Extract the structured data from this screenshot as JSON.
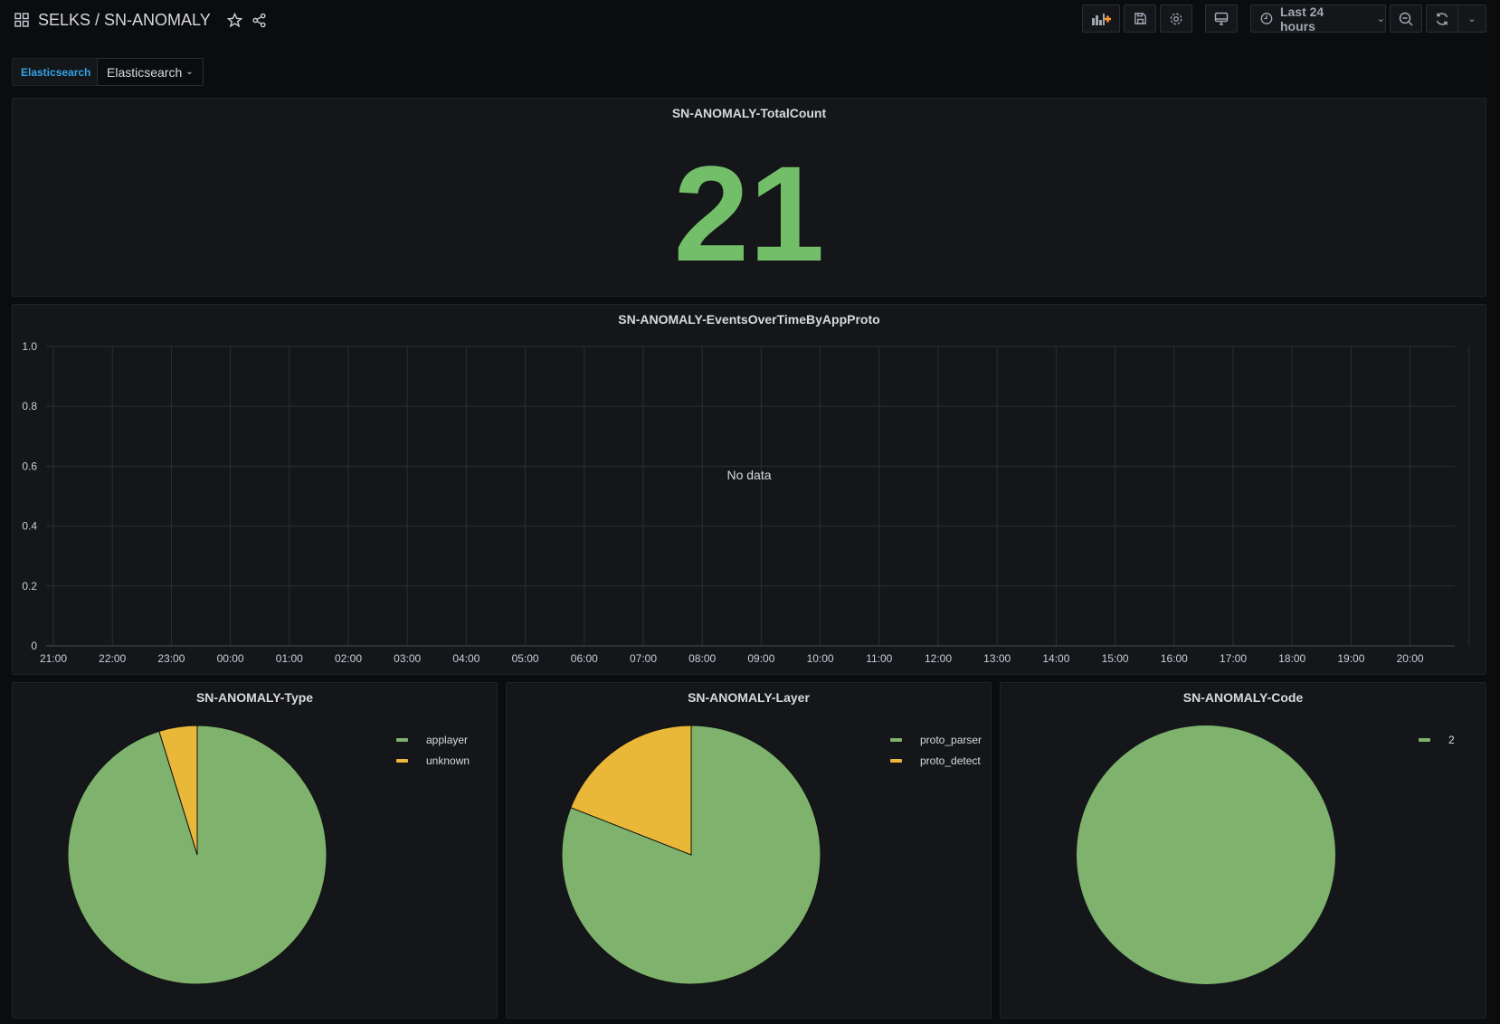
{
  "header": {
    "title": "SELKS / SN-ANOMALY",
    "time_range": "Last 24 hours"
  },
  "variables": {
    "label": "Elasticsearch",
    "value": "Elasticsearch"
  },
  "colors": {
    "green": "#7eb26d",
    "yellow": "#eab839",
    "stat": "#73bf69"
  },
  "stat": {
    "title": "SN-ANOMALY-TotalCount",
    "value": "21"
  },
  "chart_data": [
    {
      "type": "line",
      "title": "SN-ANOMALY-EventsOverTimeByAppProto",
      "no_data": "No data",
      "yticks": [
        "1.0",
        "0.8",
        "0.6",
        "0.4",
        "0.2",
        "0"
      ],
      "ylim": [
        0,
        1
      ],
      "xticks": [
        "21:00",
        "22:00",
        "23:00",
        "00:00",
        "01:00",
        "02:00",
        "03:00",
        "04:00",
        "05:00",
        "06:00",
        "07:00",
        "08:00",
        "09:00",
        "10:00",
        "11:00",
        "12:00",
        "13:00",
        "14:00",
        "15:00",
        "16:00",
        "17:00",
        "18:00",
        "19:00",
        "20:00"
      ],
      "series": []
    },
    {
      "type": "pie",
      "title": "SN-ANOMALY-Type",
      "slices": [
        {
          "name": "applayer",
          "value": 20,
          "color": "#7eb26d"
        },
        {
          "name": "unknown",
          "value": 1,
          "color": "#eab839"
        }
      ]
    },
    {
      "type": "pie",
      "title": "SN-ANOMALY-Layer",
      "slices": [
        {
          "name": "proto_parser",
          "value": 17,
          "color": "#7eb26d"
        },
        {
          "name": "proto_detect",
          "value": 4,
          "color": "#eab839"
        }
      ]
    },
    {
      "type": "pie",
      "title": "SN-ANOMALY-Code",
      "slices": [
        {
          "name": "2",
          "value": 21,
          "color": "#7eb26d"
        }
      ]
    }
  ]
}
